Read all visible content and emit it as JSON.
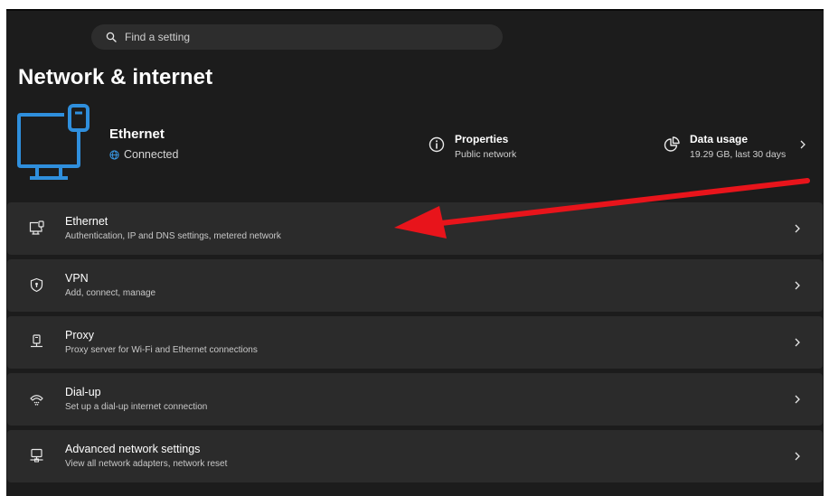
{
  "search": {
    "placeholder": "Find a setting"
  },
  "page": {
    "title": "Network & internet"
  },
  "hero": {
    "name": "Ethernet",
    "status": "Connected",
    "properties": {
      "title": "Properties",
      "subtitle": "Public network"
    },
    "data_usage": {
      "title": "Data usage",
      "subtitle": "19.29 GB, last 30 days"
    }
  },
  "items": [
    {
      "title": "Ethernet",
      "subtitle": "Authentication, IP and DNS settings, metered network",
      "icon": "ethernet-icon"
    },
    {
      "title": "VPN",
      "subtitle": "Add, connect, manage",
      "icon": "vpn-shield-icon"
    },
    {
      "title": "Proxy",
      "subtitle": "Proxy server for Wi-Fi and Ethernet connections",
      "icon": "proxy-icon"
    },
    {
      "title": "Dial-up",
      "subtitle": "Set up a dial-up internet connection",
      "icon": "dial-up-icon"
    },
    {
      "title": "Advanced network settings",
      "subtitle": "View all network adapters, network reset",
      "icon": "advanced-network-icon"
    }
  ],
  "colors": {
    "background": "#1c1c1c",
    "card": "#2b2b2b",
    "accent": "#3a9be8",
    "annotation": "#e8141b"
  }
}
